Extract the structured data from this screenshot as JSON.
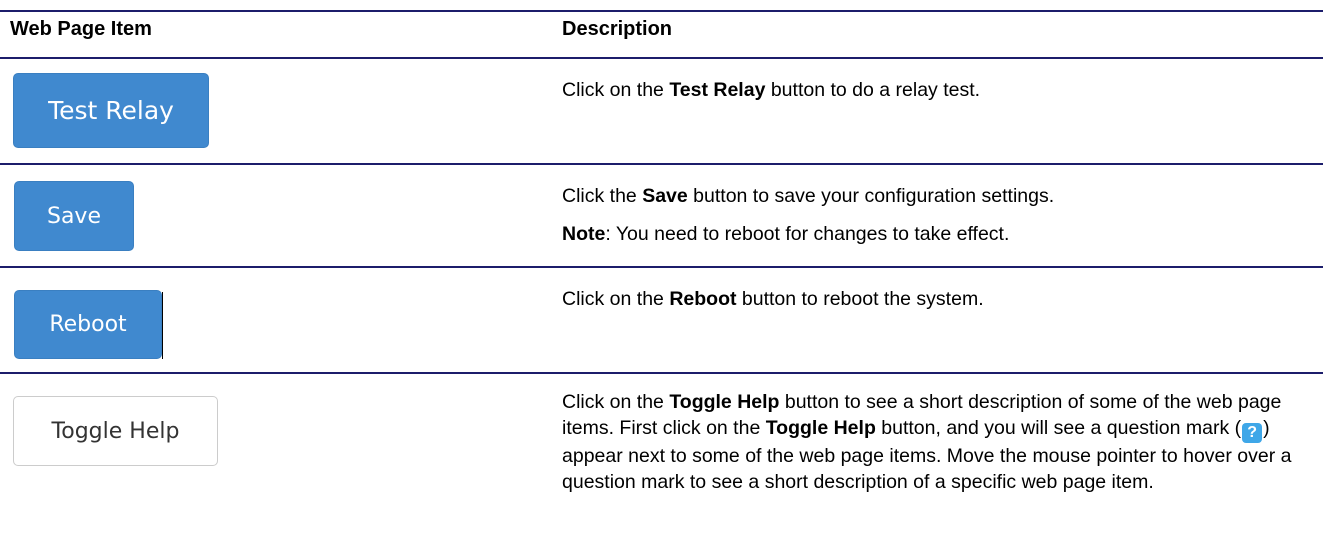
{
  "table": {
    "headers": {
      "item": "Web Page Item",
      "description": "Description"
    },
    "rows": [
      {
        "button_label": "Test Relay",
        "desc_pre": "Click on the ",
        "desc_bold": "Test Relay",
        "desc_post": " button to do a relay test."
      },
      {
        "button_label": "Save",
        "desc_pre": "Click the ",
        "desc_bold": "Save",
        "desc_post": " button to save your configuration settings.",
        "note_label": "Note",
        "note_text": ": You need to reboot for changes to take effect."
      },
      {
        "button_label": "Reboot",
        "desc_pre": "Click on the ",
        "desc_bold": "Reboot",
        "desc_post": " button to reboot the system."
      },
      {
        "button_label": "Toggle Help",
        "desc_pre": "Click on the ",
        "desc_bold": "Toggle Help",
        "desc_mid1": " button to see a short description of some of the web page items. First click on the ",
        "desc_bold2": "Toggle Help",
        "desc_mid2": " button, and you will see a question mark (",
        "help_icon_glyph": "?",
        "desc_post": ") appear next to some of the web page items. Move the mouse pointer to hover over a question mark to see a short description of a specific web page item."
      }
    ]
  },
  "colors": {
    "rule": "#1c1d6b",
    "primary_button": "#4089cf",
    "default_button_border": "#cccccc",
    "help_icon": "#3fa7e8"
  },
  "icons": {
    "help": "question-mark-icon"
  }
}
